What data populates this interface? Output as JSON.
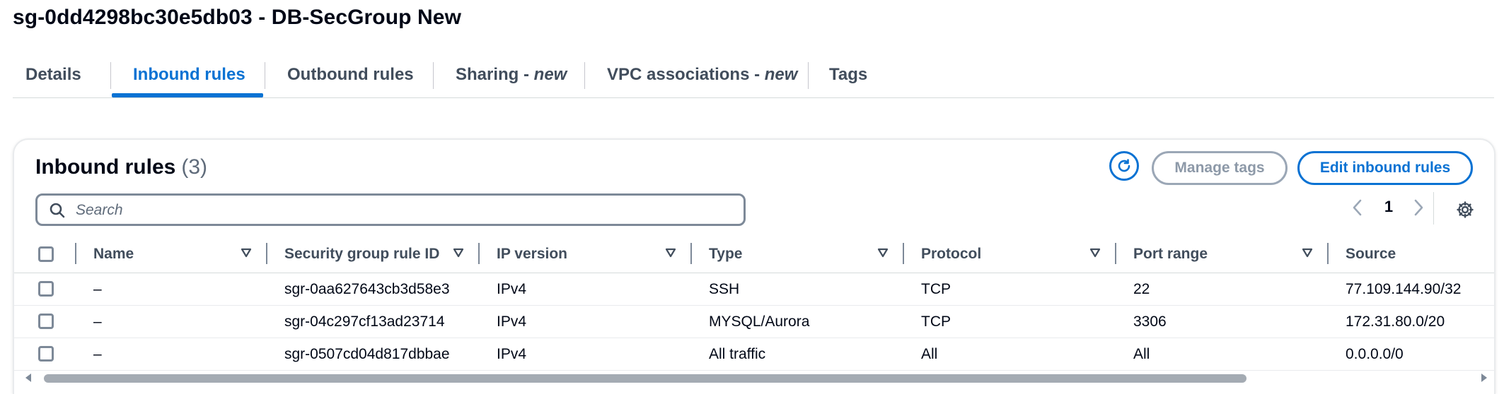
{
  "page": {
    "title": "sg-0dd4298bc30e5db03 - DB-SecGroup New"
  },
  "tabs": [
    {
      "label": "Details",
      "suffix": ""
    },
    {
      "label": "Inbound rules",
      "suffix": ""
    },
    {
      "label": "Outbound rules",
      "suffix": ""
    },
    {
      "label": "Sharing - ",
      "suffix": "new"
    },
    {
      "label": "VPC associations - ",
      "suffix": "new"
    },
    {
      "label": "Tags",
      "suffix": ""
    }
  ],
  "active_tab": "Inbound rules",
  "panel": {
    "title": "Inbound rules",
    "count": "(3)",
    "manage_tags_label": "Manage tags",
    "edit_label": "Edit inbound rules",
    "search_placeholder": "Search",
    "page_number": "1"
  },
  "table": {
    "columns": [
      "Name",
      "Security group rule ID",
      "IP version",
      "Type",
      "Protocol",
      "Port range",
      "Source"
    ],
    "rows": [
      {
        "name": "–",
        "rule_id": "sgr-0aa627643cb3d58e3",
        "ip_version": "IPv4",
        "type": "SSH",
        "protocol": "TCP",
        "port_range": "22",
        "source": "77.109.144.90/32"
      },
      {
        "name": "–",
        "rule_id": "sgr-04c297cf13ad23714",
        "ip_version": "IPv4",
        "type": "MYSQL/Aurora",
        "protocol": "TCP",
        "port_range": "3306",
        "source": "172.31.80.0/20"
      },
      {
        "name": "–",
        "rule_id": "sgr-0507cd04d817dbbae",
        "ip_version": "IPv4",
        "type": "All traffic",
        "protocol": "All",
        "port_range": "All",
        "source": "0.0.0.0/0"
      }
    ]
  },
  "colors": {
    "accent": "#0972d3",
    "text": "#000716",
    "muted": "#5f6b7a",
    "border": "#7d8998"
  }
}
